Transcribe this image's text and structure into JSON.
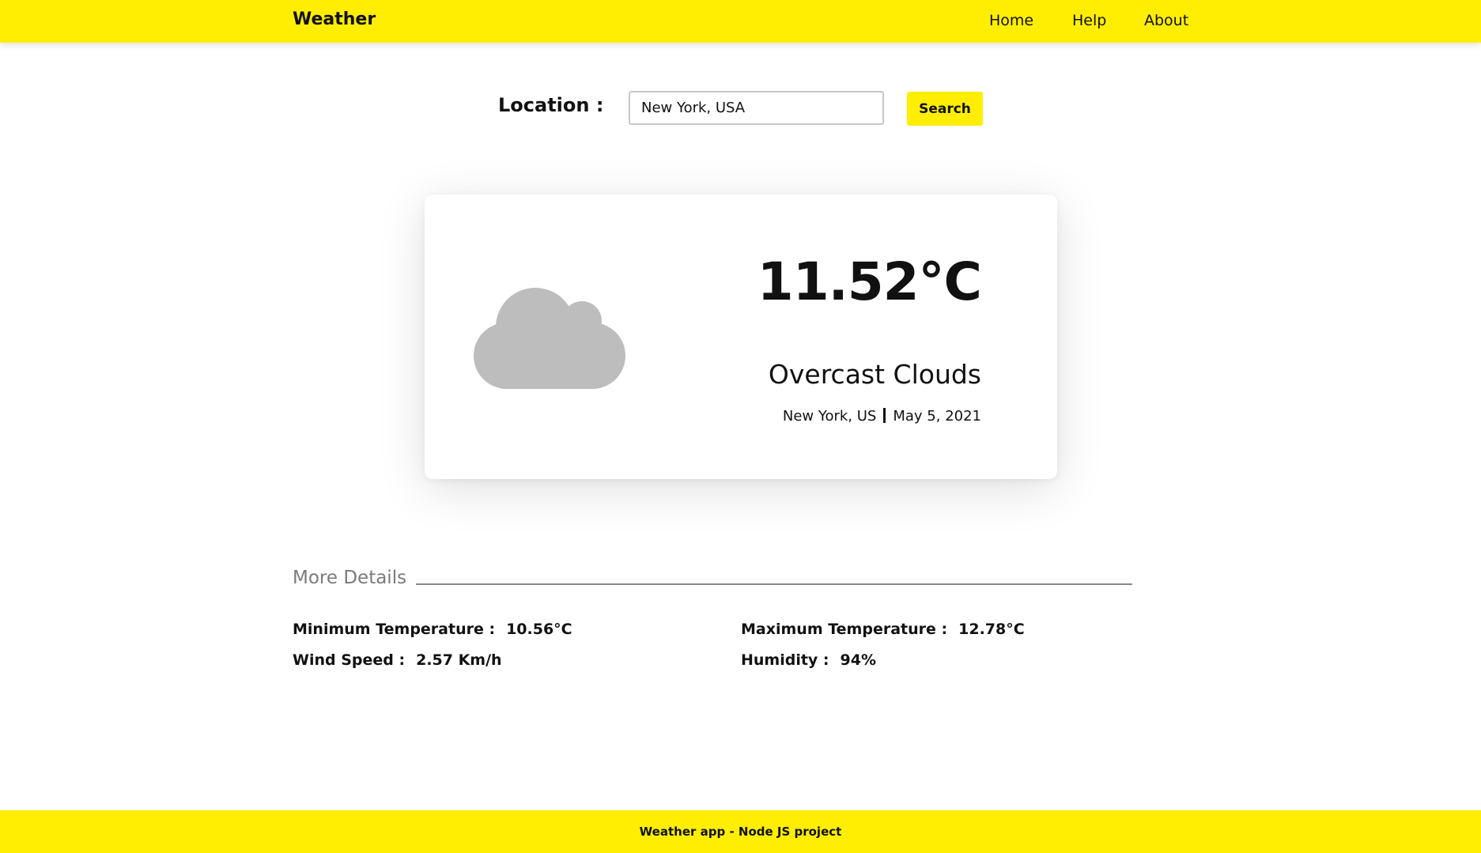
{
  "header": {
    "brand": "Weather",
    "nav": [
      "Home",
      "Help",
      "About"
    ]
  },
  "search": {
    "label": "Location :",
    "value": "New York, USA",
    "button_label": "Search"
  },
  "current": {
    "temperature": "11.52°C",
    "description": "Overcast Clouds",
    "city": "New York, US",
    "date": "May 5, 2021",
    "icon": "cloud-icon"
  },
  "details": {
    "title": "More Details",
    "min_temp_label": "Minimum Temperature :",
    "min_temp_value": "10.56°C",
    "max_temp_label": "Maximum Temperature :",
    "max_temp_value": "12.78°C",
    "wind_label": "Wind Speed :",
    "wind_value": "2.57 Km/h",
    "humidity_label": "Humidity :",
    "humidity_value": "94%"
  },
  "footer": {
    "text": "Weather app - Node JS project"
  },
  "colors": {
    "accent": "#ffee00",
    "cloud": "#bdbdbd",
    "muted_text": "#7a7a7a"
  }
}
